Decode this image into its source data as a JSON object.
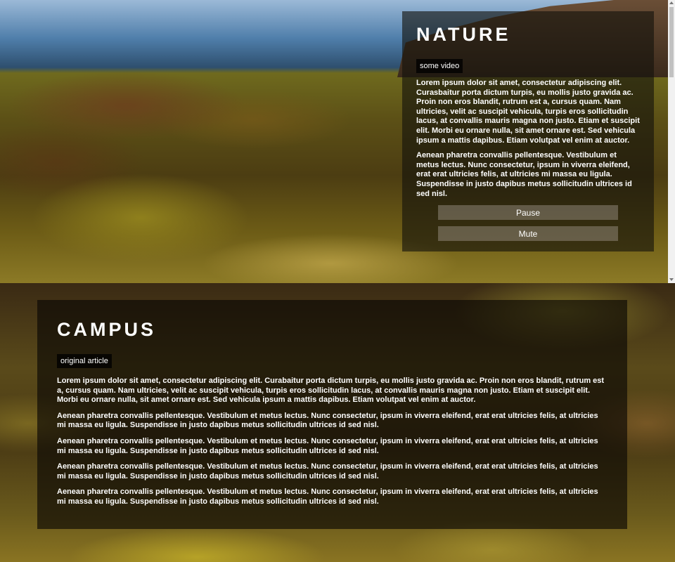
{
  "nature": {
    "title": "NATURE",
    "tag": "some video",
    "paragraphs": [
      "Lorem ipsum dolor sit amet, consectetur adipiscing elit. Curasbaitur porta dictum turpis, eu mollis justo gravida ac. Proin non eros blandit, rutrum est a, cursus quam. Nam ultricies, velit ac suscipit vehicula, turpis eros sollicitudin lacus, at convallis mauris magna non justo. Etiam et suscipit elit. Morbi eu ornare nulla, sit amet ornare est. Sed vehicula ipsum a mattis dapibus. Etiam volutpat vel enim at auctor.",
      "Aenean pharetra convallis pellentesque. Vestibulum et metus lectus. Nunc consectetur, ipsum in viverra eleifend, erat erat ultricies felis, at ultricies mi massa eu ligula. Suspendisse in justo dapibus metus sollicitudin ultrices id sed nisl."
    ],
    "pause_label": "Pause",
    "mute_label": "Mute"
  },
  "campus": {
    "title": "CAMPUS",
    "tag": "original article",
    "paragraphs": [
      "Lorem ipsum dolor sit amet, consectetur adipiscing elit. Curabaitur porta dictum turpis, eu mollis justo gravida ac. Proin non eros blandit, rutrum est a, cursus quam. Nam ultricies, velit ac suscipit vehicula, turpis eros sollicitudin lacus, at convallis mauris magna non justo. Etiam et suscipit elit. Morbi eu ornare nulla, sit amet ornare est. Sed vehicula ipsum a mattis dapibus. Etiam volutpat vel enim at auctor.",
      "Aenean pharetra convallis pellentesque. Vestibulum et metus lectus. Nunc consectetur, ipsum in viverra eleifend, erat erat ultricies felis, at ultricies mi massa eu ligula. Suspendisse in justo dapibus metus sollicitudin ultrices id sed nisl.",
      "Aenean pharetra convallis pellentesque. Vestibulum et metus lectus. Nunc consectetur, ipsum in viverra eleifend, erat erat ultricies felis, at ultricies mi massa eu ligula. Suspendisse in justo dapibus metus sollicitudin ultrices id sed nisl.",
      "Aenean pharetra convallis pellentesque. Vestibulum et metus lectus. Nunc consectetur, ipsum in viverra eleifend, erat erat ultricies felis, at ultricies mi massa eu ligula. Suspendisse in justo dapibus metus sollicitudin ultrices id sed nisl.",
      "Aenean pharetra convallis pellentesque. Vestibulum et metus lectus. Nunc consectetur, ipsum in viverra eleifend, erat erat ultricies felis, at ultricies mi massa eu ligula. Suspendisse in justo dapibus metus sollicitudin ultrices id sed nisl."
    ]
  },
  "colors": {
    "panel_overlay": "#14120c",
    "tag_background": "#000000",
    "button_background": "#aaa096",
    "text": "#ffffff"
  }
}
